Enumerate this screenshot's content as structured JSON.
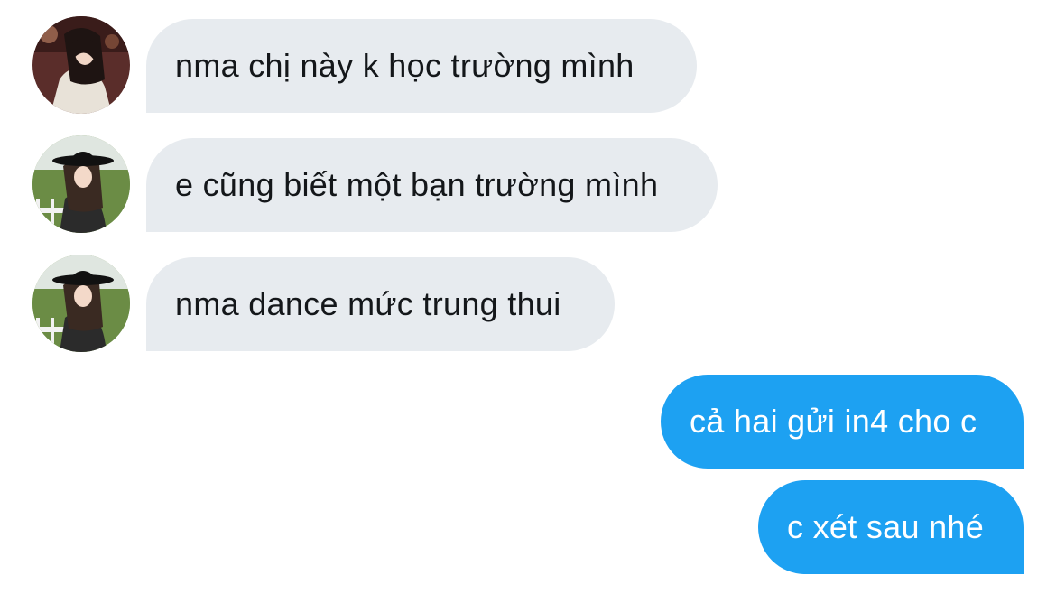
{
  "conversation": {
    "messages": [
      {
        "sender": "contact",
        "avatar": "avatar-contact-a",
        "text": "nma chị này k học trường mình"
      },
      {
        "sender": "contact",
        "avatar": "avatar-contact-b",
        "text": "e cũng biết một bạn trường mình"
      },
      {
        "sender": "contact",
        "avatar": "avatar-contact-b",
        "text": "nma dance mức trung thui"
      },
      {
        "sender": "me",
        "text": "cả hai gửi in4 cho c"
      },
      {
        "sender": "me",
        "text": "c xét sau nhé"
      }
    ]
  },
  "colors": {
    "incoming_bubble": "#e7ebef",
    "incoming_text": "#14171a",
    "outgoing_bubble": "#1da1f2",
    "outgoing_text": "#ffffff"
  }
}
